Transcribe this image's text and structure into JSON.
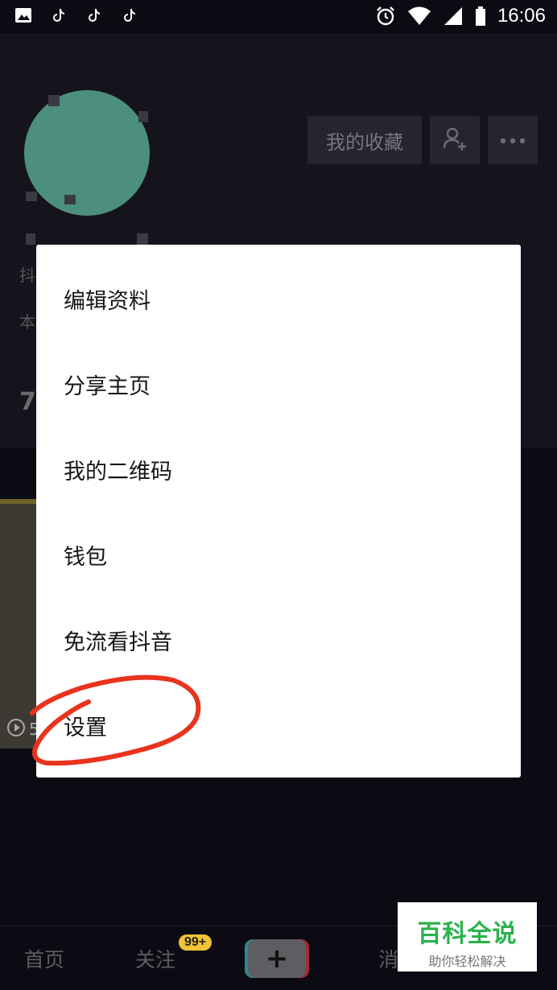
{
  "status_bar": {
    "time": "16:06",
    "left_icons": [
      "gallery-icon",
      "tiktok-icon",
      "tiktok-icon",
      "tiktok-icon"
    ],
    "right_icons": [
      "alarm-icon",
      "wifi-icon",
      "signal-icon",
      "battery-icon"
    ]
  },
  "profile": {
    "favorites_label": "我的收藏",
    "name_fragment": "抖",
    "bio_fragment": "本",
    "count_fragment": "7",
    "play_count_fragment": "5"
  },
  "menu": {
    "items": [
      {
        "label": "编辑资料"
      },
      {
        "label": "分享主页"
      },
      {
        "label": "我的二维码"
      },
      {
        "label": "钱包"
      },
      {
        "label": "免流看抖音"
      },
      {
        "label": "设置"
      }
    ]
  },
  "bottom_nav": {
    "home_label": "首页",
    "follow_label": "关注",
    "follow_badge": "99+",
    "create_label": "+",
    "messages_label": "消"
  },
  "watermark": {
    "title": "百科全说",
    "subtitle": "助你轻松解决"
  },
  "colors": {
    "background": "#0c0b14",
    "menu_bg": "#ffffff",
    "annotation_red": "#e8331d",
    "badge": "#f0c434",
    "watermark_green": "#2bb24c"
  }
}
